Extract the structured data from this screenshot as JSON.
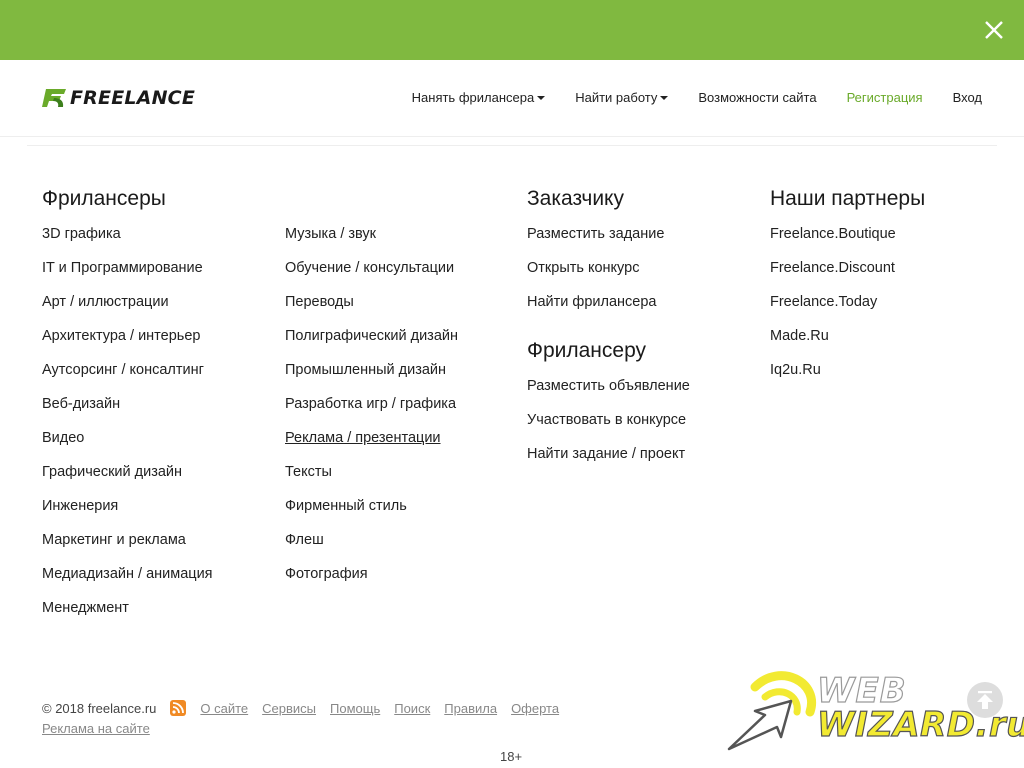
{
  "colors": {
    "topbar": "#80b940",
    "accent_green": "#6aaa2a",
    "watermark_yellow": "#f2ea32"
  },
  "header": {
    "logo_text": "FREELANCE",
    "nav": {
      "hire": "Нанять фрилансера",
      "find_work": "Найти работу",
      "features": "Возможности сайта",
      "register": "Регистрация",
      "login": "Вход"
    }
  },
  "freelancers": {
    "title": "Фрилансеры",
    "col1": [
      "3D графика",
      "IT и Программирование",
      "Арт / иллюстрации",
      "Архитектура / интерьер",
      "Аутсорсинг / консалтинг",
      "Веб-дизайн",
      "Видео",
      "Графический дизайн",
      "Инженерия",
      "Маркетинг и реклама",
      "Медиадизайн / анимация",
      "Менеджмент"
    ],
    "col2": [
      "Музыка / звук",
      "Обучение / консультации",
      "Переводы",
      "Полиграфический дизайн",
      "Промышленный дизайн",
      "Разработка игр / графика",
      "Реклама / презентации",
      "Тексты",
      "Фирменный стиль",
      "Флеш",
      "Фотография"
    ]
  },
  "customer": {
    "title": "Заказчику",
    "items": [
      "Разместить задание",
      "Открыть конкурс",
      "Найти фрилансера"
    ]
  },
  "freelancer": {
    "title": "Фрилансеру",
    "items": [
      "Разместить объявление",
      "Участвовать в конкурсе",
      "Найти задание / проект"
    ]
  },
  "partners": {
    "title": "Наши партнеры",
    "items": [
      "Freelance.Boutique",
      "Freelance.Discount",
      "Freelance.Today",
      "Made.Ru",
      "Iq2u.Ru"
    ]
  },
  "footer": {
    "copyright": "© 2018 freelance.ru",
    "links": [
      "О сайте",
      "Сервисы",
      "Помощь",
      "Поиск",
      "Правила",
      "Оферта"
    ],
    "ad_link": "Реклама на сайте",
    "age": "18+"
  },
  "watermark": {
    "line1": "WEB",
    "line2": "WIZARD.ru"
  },
  "icons": {
    "close": "close-icon",
    "logo": "freelance-logo-icon",
    "rss": "rss-icon",
    "scroll_top": "arrow-up-icon",
    "watermark": "cursor-arrow-icon"
  }
}
